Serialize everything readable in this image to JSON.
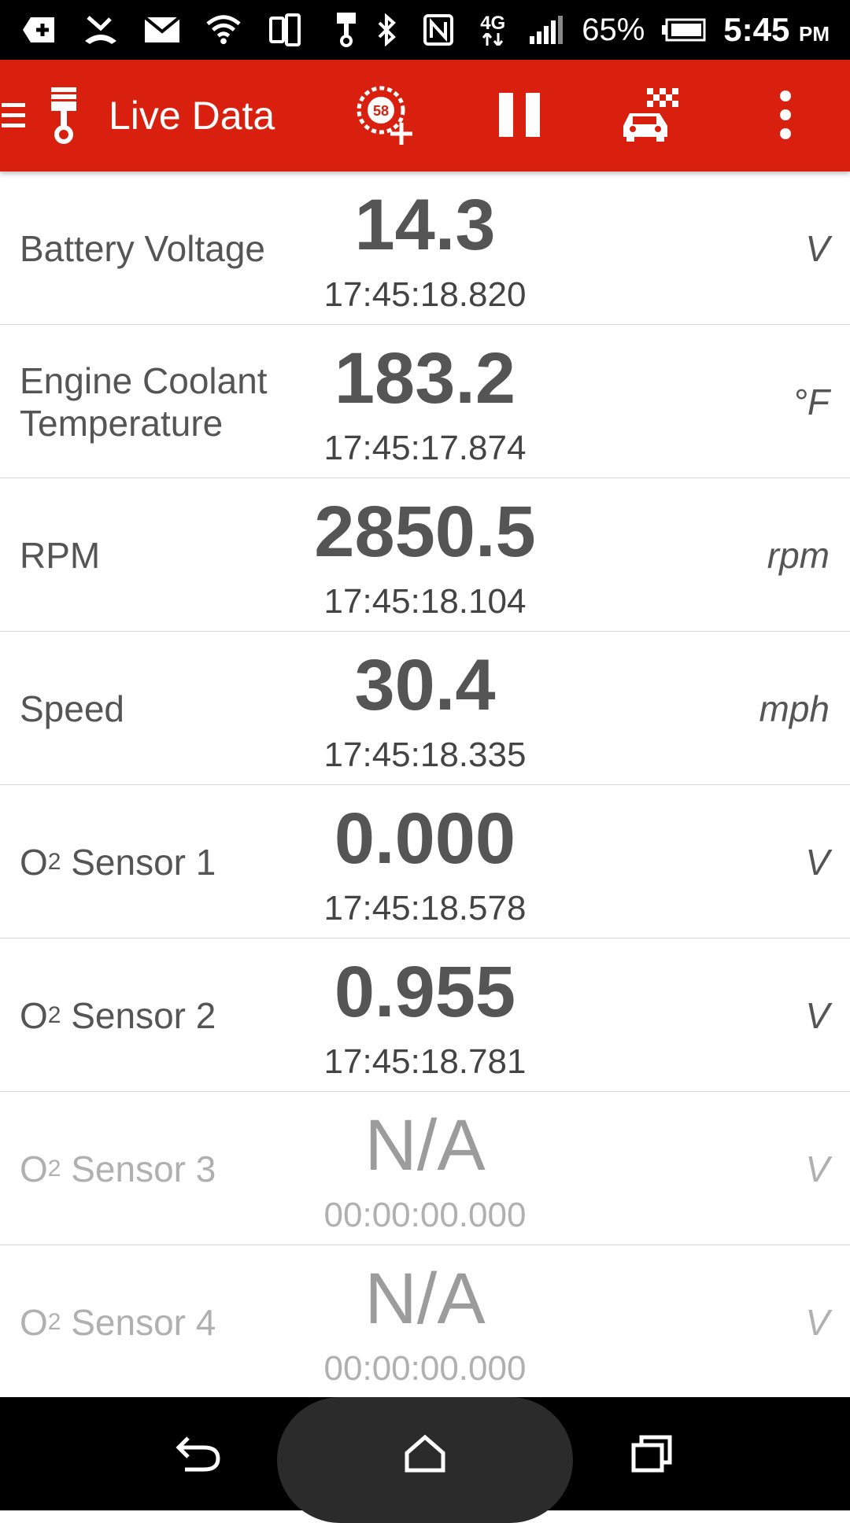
{
  "status_bar": {
    "battery_percent": "65%",
    "time": "5:45",
    "ampm": "PM",
    "network": "4G"
  },
  "app_bar": {
    "title": "Live Data",
    "gauge_badge": "58"
  },
  "rows": [
    {
      "label": "Battery Voltage",
      "value": "14.3",
      "timestamp": "17:45:18.820",
      "unit": "V"
    },
    {
      "label": "Engine Coolant Temperature",
      "value": "183.2",
      "timestamp": "17:45:17.874",
      "unit": "°F"
    },
    {
      "label": "RPM",
      "value": "2850.5",
      "timestamp": "17:45:18.104",
      "unit": "rpm"
    },
    {
      "label": "Speed",
      "value": "30.4",
      "timestamp": "17:45:18.335",
      "unit": "mph"
    },
    {
      "label_main": "O",
      "label_sub": "2",
      "label_rest": " Sensor 1",
      "value": "0.000",
      "timestamp": "17:45:18.578",
      "unit": "V"
    },
    {
      "label_main": "O",
      "label_sub": "2",
      "label_rest": " Sensor 2",
      "value": "0.955",
      "timestamp": "17:45:18.781",
      "unit": "V"
    },
    {
      "label_main": "O",
      "label_sub": "2",
      "label_rest": " Sensor 3",
      "value": "N/A",
      "timestamp": "00:00:00.000",
      "unit": "V"
    },
    {
      "label_main": "O",
      "label_sub": "2",
      "label_rest": " Sensor 4",
      "value": "N/A",
      "timestamp": "00:00:00.000",
      "unit": "V"
    }
  ],
  "colors": {
    "app_bar": "#d91f0e",
    "text_active": "#555555",
    "text_inactive": "#b0b0b0"
  },
  "icons": {
    "status": [
      "add-notification-icon",
      "missed-call-icon",
      "mail-icon",
      "wifi-icon",
      "phone-rotate-icon",
      "piston-icon",
      "bluetooth-icon",
      "nfc-icon",
      "signal-icon",
      "battery-icon"
    ],
    "app_bar": [
      "menu-icon",
      "piston-icon",
      "add-gauge-icon",
      "pause-icon",
      "race-car-icon",
      "overflow-menu-icon"
    ],
    "nav": [
      "back-icon",
      "home-icon",
      "recents-icon"
    ]
  }
}
